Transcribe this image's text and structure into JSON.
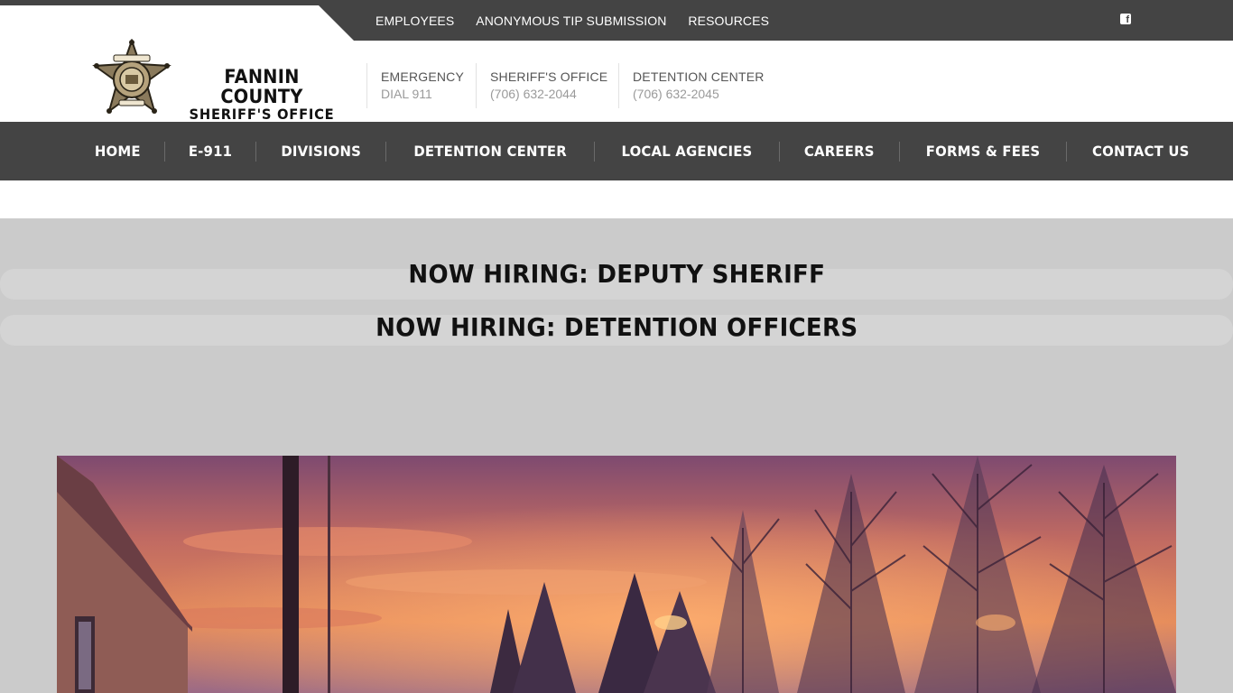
{
  "utility_nav": {
    "links": [
      "EMPLOYEES",
      "ANONYMOUS TIP SUBMISSION",
      "RESOURCES"
    ],
    "social_icon": "facebook-icon"
  },
  "header": {
    "brand_line1": "FANNIN COUNTY",
    "brand_line2": "SHERIFF'S OFFICE",
    "contacts": [
      {
        "label": "EMERGENCY",
        "value": "DIAL 911"
      },
      {
        "label": "SHERIFF'S OFFICE",
        "value": "(706) 632-2044"
      },
      {
        "label": "DETENTION CENTER",
        "value": "(706) 632-2045"
      }
    ]
  },
  "main_nav": {
    "items": [
      "HOME",
      "E-911",
      "DIVISIONS",
      "DETENTION CENTER",
      "LOCAL AGENCIES",
      "CAREERS",
      "FORMS & FEES",
      "CONTACT US"
    ]
  },
  "hero": {
    "line1": "NOW HIRING:  DEPUTY SHERIFF",
    "line2": "NOW HIRING:  DETENTION OFFICERS"
  },
  "colors": {
    "bar": "#444444",
    "hero_bg": "#cbcbcb",
    "star": "#8a7a5c"
  }
}
